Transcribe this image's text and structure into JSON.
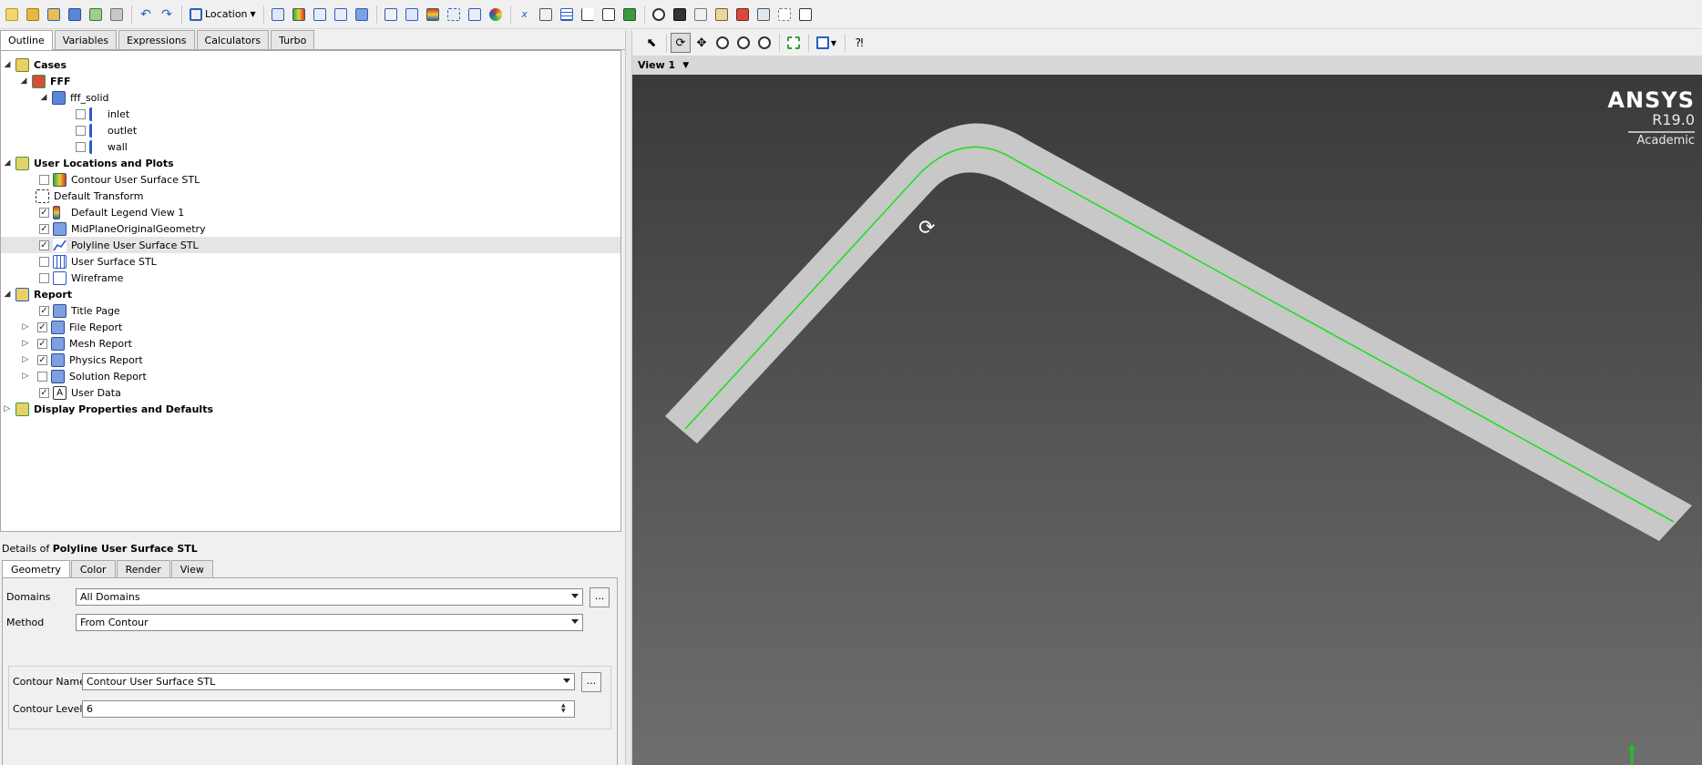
{
  "toolbar": {
    "location_label": "Location",
    "icons": [
      "new-file-icon",
      "open-file-icon",
      "load-state-icon",
      "save-state-icon",
      "refresh-icon",
      "screenshot-icon",
      "undo-icon",
      "redo-icon",
      "location-icon",
      "vector-icon",
      "contour-icon",
      "streamline-icon",
      "volume-rendering-icon",
      "particle-track-icon",
      "text-icon",
      "coordinate-frame-icon",
      "legend-icon",
      "instance-transform-icon",
      "clip-plane-icon",
      "color-map-icon",
      "variable-icon",
      "expression-icon",
      "table-icon",
      "chart-icon",
      "comment-icon",
      "figure-icon",
      "timestep-icon",
      "animation-icon",
      "quick-editor-icon",
      "query-icon",
      "report-icon",
      "mesh-icon",
      "command-editor-icon"
    ]
  },
  "outline_tabs": [
    "Outline",
    "Variables",
    "Expressions",
    "Calculators",
    "Turbo"
  ],
  "tree": {
    "cases": "Cases",
    "fff": "FFF",
    "fff_solid": "fff_solid",
    "inlet": "inlet",
    "outlet": "outlet",
    "wall": "wall",
    "user_locations": "User Locations and Plots",
    "contour_surface": "Contour User Surface STL",
    "default_transform": "Default Transform",
    "default_legend": "Default Legend View 1",
    "midplane": "MidPlaneOriginalGeometry",
    "polyline": "Polyline User Surface STL",
    "user_surface": "User Surface STL",
    "wireframe": "Wireframe",
    "report": "Report",
    "title_page": "Title Page",
    "file_report": "File Report",
    "mesh_report": "Mesh Report",
    "physics_report": "Physics Report",
    "solution_report": "Solution Report",
    "user_data": "User Data",
    "display_props": "Display Properties and Defaults"
  },
  "details": {
    "prefix": "Details of ",
    "object": "Polyline User Surface STL",
    "tabs": [
      "Geometry",
      "Color",
      "Render",
      "View"
    ],
    "domains_label": "Domains",
    "domains_value": "All Domains",
    "method_label": "Method",
    "method_value": "From Contour",
    "contour_name_label": "Contour Name",
    "contour_name_value": "Contour User Surface STL",
    "contour_level_label": "Contour Level",
    "contour_level_value": "6",
    "dots": "..."
  },
  "viewer": {
    "view_label": "View 1",
    "brand_name": "ANSYS",
    "brand_version": "R19.0",
    "brand_edition": "Academic",
    "colors": {
      "background_top": "#3a3a3a",
      "background_bottom": "#6e6e6e",
      "pipe": "#c8c8c8",
      "polyline": "#22dd22"
    }
  }
}
